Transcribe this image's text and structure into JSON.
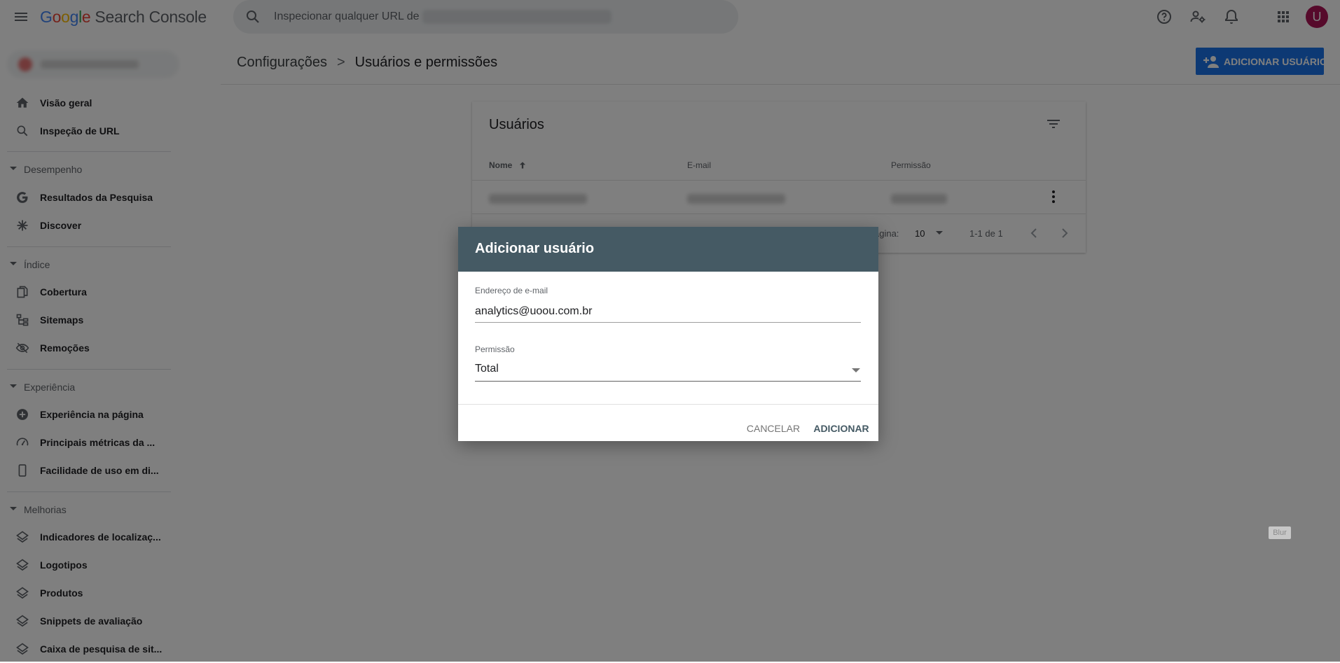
{
  "topbar": {
    "logo": {
      "brand": "Google",
      "product": "Search Console"
    },
    "search_placeholder": "Inspecionar qualquer URL de",
    "avatar_letter": "U"
  },
  "sidebar": {
    "items_top": [
      {
        "label": "Visão geral",
        "icon": "home-icon"
      },
      {
        "label": "Inspeção de URL",
        "icon": "search-icon"
      }
    ],
    "sections": [
      {
        "title": "Desempenho",
        "items": [
          {
            "label": "Resultados da Pesquisa",
            "icon": "google-g-icon"
          },
          {
            "label": "Discover",
            "icon": "asterisk-icon"
          }
        ]
      },
      {
        "title": "Índice",
        "items": [
          {
            "label": "Cobertura",
            "icon": "file-copy-icon"
          },
          {
            "label": "Sitemaps",
            "icon": "sitemap-icon"
          },
          {
            "label": "Remoções",
            "icon": "visibility-off-icon"
          }
        ]
      },
      {
        "title": "Experiência",
        "items": [
          {
            "label": "Experiência na página",
            "icon": "add-circle-icon"
          },
          {
            "label": "Principais métricas da ...",
            "icon": "speed-icon"
          },
          {
            "label": "Facilidade de uso em di...",
            "icon": "smartphone-icon"
          }
        ]
      },
      {
        "title": "Melhorias",
        "items": [
          {
            "label": "Indicadores de localizaç...",
            "icon": "layers-icon"
          },
          {
            "label": "Logotipos",
            "icon": "layers-icon"
          },
          {
            "label": "Produtos",
            "icon": "layers-icon"
          },
          {
            "label": "Snippets de avaliação",
            "icon": "layers-icon"
          },
          {
            "label": "Caixa de pesquisa de sit...",
            "icon": "layers-icon"
          }
        ]
      }
    ]
  },
  "header": {
    "breadcrumb_parent": "Configurações",
    "breadcrumb_separator": ">",
    "breadcrumb_current": "Usuários e permissões",
    "add_user_label": "ADICIONAR USUÁRIO"
  },
  "card": {
    "title": "Usuários",
    "columns": [
      "Nome",
      "E-mail",
      "Permissão"
    ],
    "pagination": {
      "per_page_label": "ágina:",
      "per_page_value": "10",
      "range": "1-1 de 1"
    }
  },
  "dialog": {
    "title": "Adicionar usuário",
    "email_label": "Endereço de e-mail",
    "email_value": "analytics@uoou.com.br",
    "permission_label": "Permissão",
    "permission_value": "Total",
    "cancel_label": "CANCELAR",
    "add_label": "ADICIONAR"
  },
  "overlay": {
    "blur_tag": "Blur"
  },
  "colors": {
    "dialog_header": "#455a64",
    "primary_button": "#1a73e8",
    "avatar": "#ad1457"
  }
}
